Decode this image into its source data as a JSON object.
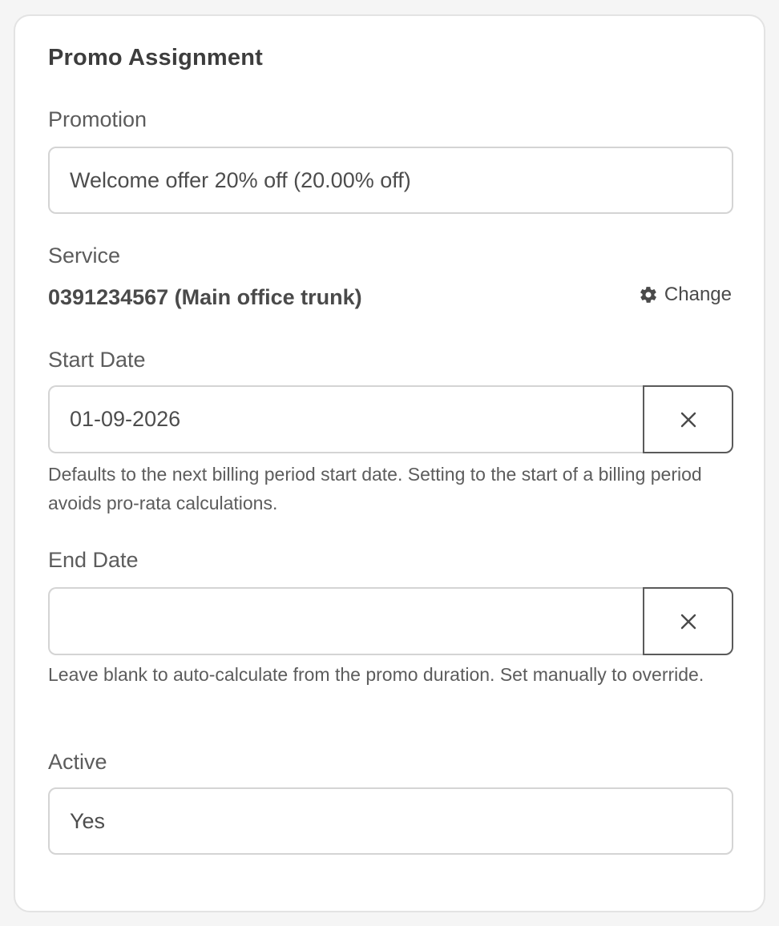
{
  "card": {
    "title": "Promo Assignment"
  },
  "promotion": {
    "label": "Promotion",
    "value": "Welcome offer 20% off (20.00% off)"
  },
  "service": {
    "label": "Service",
    "value": "0391234567 (Main office trunk)",
    "change_label": "Change",
    "change_icon": "gear-icon"
  },
  "start_date": {
    "label": "Start Date",
    "value": "01-09-2026",
    "clear_icon": "close-icon",
    "help": "Defaults to the next billing period start date. Setting to the start of a billing period avoids pro-rata calculations."
  },
  "end_date": {
    "label": "End Date",
    "value": "",
    "clear_icon": "close-icon",
    "help": "Leave blank to auto-calculate from the promo duration. Set manually to override."
  },
  "active": {
    "label": "Active",
    "value": "Yes"
  },
  "colors": {
    "page_background": "#f5f5f5",
    "card_border": "#e3e3e3",
    "input_border": "#d4d4d4",
    "button_border": "#5a5a5a",
    "text": "#4a4a4a"
  }
}
